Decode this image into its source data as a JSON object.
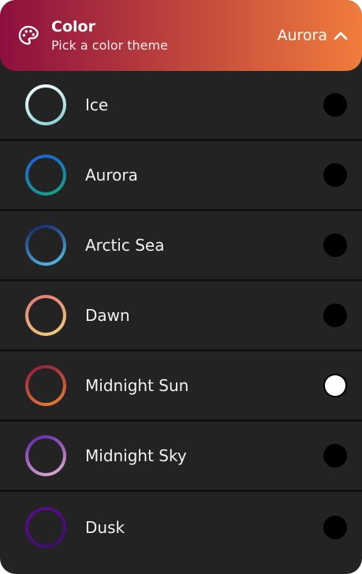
{
  "header": {
    "title": "Color",
    "subtitle": "Pick a color theme",
    "current_value": "Aurora",
    "icon": "palette-icon",
    "gradient": [
      "#8c0f3e",
      "#f07c3c"
    ]
  },
  "themes": [
    {
      "label": "Ice",
      "colors": [
        "#ffffff",
        "#7ed0cf"
      ],
      "selected": false
    },
    {
      "label": "Aurora",
      "colors": [
        "#1f5bd9",
        "#13a87f"
      ],
      "selected": false
    },
    {
      "label": "Arctic Sea",
      "colors": [
        "#141a66",
        "#58c9ec"
      ],
      "selected": false
    },
    {
      "label": "Dawn",
      "colors": [
        "#e4737a",
        "#f2d27a"
      ],
      "selected": false
    },
    {
      "label": "Midnight Sun",
      "colors": [
        "#8e1640",
        "#f08036"
      ],
      "selected": true
    },
    {
      "label": "Midnight Sky",
      "colors": [
        "#5c1fa8",
        "#e8b3d3"
      ],
      "selected": false
    },
    {
      "label": "Dusk",
      "colors": [
        "#5a0b8f",
        "#3c0f6b"
      ],
      "selected": false
    }
  ],
  "colors": {
    "panel_bg": "#232323",
    "divider": "#111111",
    "radio_off": "#000000",
    "radio_on": "#ffffff"
  }
}
